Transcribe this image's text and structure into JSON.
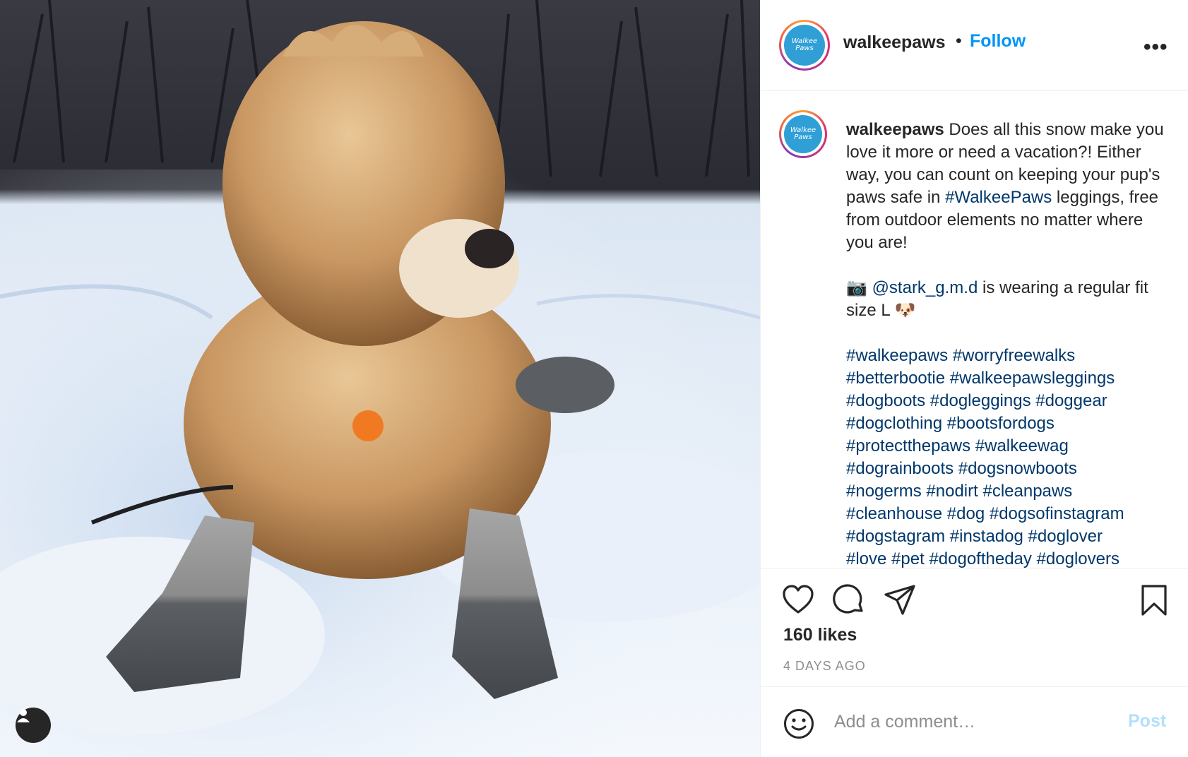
{
  "photo": {
    "alt_icon": "user-tag-icon"
  },
  "header": {
    "username": "walkeepaws",
    "separator": "•",
    "follow_label": "Follow",
    "more_label": "•••",
    "avatar_text_1": "Walkee",
    "avatar_text_2": "Paws"
  },
  "caption": {
    "username": "walkeepaws",
    "text_1": " Does all this snow make you love it more or need a vacation?! Either way, you can count on keeping your pup's paws safe in ",
    "hashtag_brand": "#WalkeePaws",
    "text_2": " leggings, free from outdoor elements no matter where you are!",
    "camera_emoji": "📷",
    "mention": "@stark_g.m.d",
    "text_3": " is wearing a regular fit size L ",
    "dog_emoji": "🐶",
    "hashtags": [
      "#walkeepaws",
      "#worryfreewalks",
      "#betterbootie",
      "#walkeepawsleggings",
      "#dogboots",
      "#dogleggings",
      "#doggear",
      "#dogclothing",
      "#bootsfordogs",
      "#protectthepaws",
      "#walkeewag",
      "#dograinboots",
      "#dogsnowboots",
      "#nogerms",
      "#nodirt",
      "#cleanpaws",
      "#cleanhouse",
      "#dog",
      "#dogsofinstagram",
      "#dogstagram",
      "#instadog",
      "#doglover",
      "#love",
      "#pet",
      "#dogoftheday",
      "#doglovers"
    ]
  },
  "actions": {
    "icons": [
      "heart-icon",
      "comment-icon",
      "share-icon",
      "bookmark-icon"
    ],
    "likes": "160 likes",
    "timestamp": "4 DAYS AGO"
  },
  "comment": {
    "placeholder": "Add a comment…",
    "post_label": "Post",
    "emoji_icon": "smiley-icon"
  },
  "colors": {
    "accent": "#0095f6",
    "link": "#00376b",
    "post_disabled": "#b2dffc",
    "text": "#262626",
    "muted": "#8e8e8e"
  }
}
